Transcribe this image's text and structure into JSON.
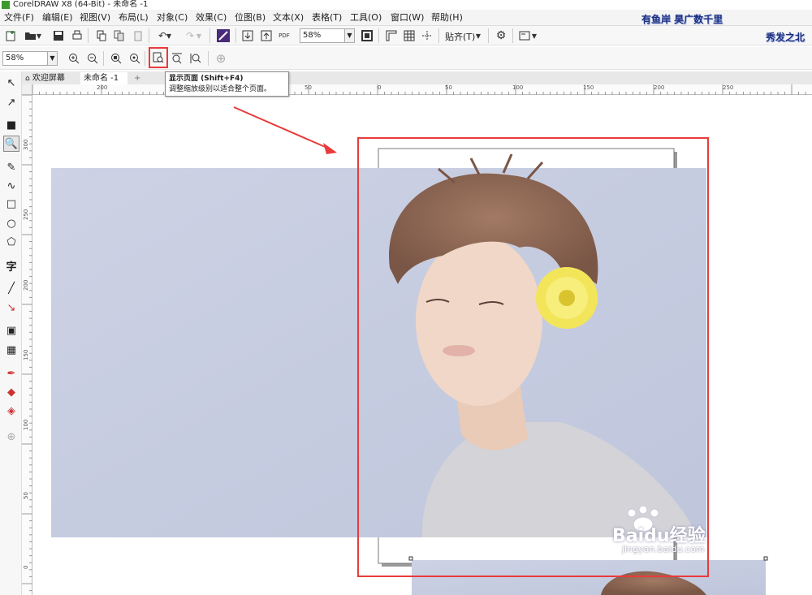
{
  "window": {
    "title": "CorelDRAW X8 (64-Bit) - 未命名 -1"
  },
  "menu": [
    "文件(F)",
    "编辑(E)",
    "视图(V)",
    "布局(L)",
    "对象(C)",
    "效果(C)",
    "位图(B)",
    "文本(X)",
    "表格(T)",
    "工具(O)",
    "窗口(W)",
    "帮助(H)"
  ],
  "banners": {
    "top": "有鱼岸 昊广数千里",
    "side": "秀发之北"
  },
  "toolbar1": {
    "zoom_value": "58%",
    "snap_label": "贴齐(T)",
    "pdf_label": "PDF"
  },
  "toolbar2": {
    "zoom_value": "58%"
  },
  "tooltip": {
    "title": "显示页面 (Shift+F4)",
    "desc": "调整缩放级别以适合整个页面。"
  },
  "tabs": {
    "welcome": "欢迎屏幕",
    "doc": "未命名 -1",
    "add": "+"
  },
  "ruler": {
    "h_labels": [
      "200",
      "150",
      "50",
      "0",
      "50",
      "100",
      "150",
      "200",
      "250"
    ],
    "v_labels": [
      "300",
      "250",
      "200",
      "150",
      "100",
      "50",
      "0"
    ]
  },
  "tool_glyphs": [
    "↖",
    "↗",
    "■",
    "🔍",
    "✎",
    "∿",
    "□",
    "○",
    "⬠",
    "字",
    "╱",
    "↘",
    "▣",
    "▦",
    "✒",
    "◆",
    "◈",
    "⊕"
  ],
  "watermark": {
    "logo": "Baidu经验",
    "url": "jingyan.baidu.com"
  },
  "colors": {
    "highlight_red": "#e83b3b",
    "photo_bg": "#c7cde0"
  }
}
